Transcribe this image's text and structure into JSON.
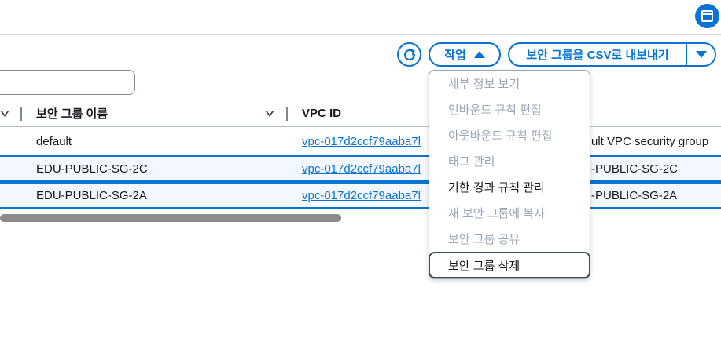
{
  "toolbar": {
    "actions_label": "작업",
    "export_label": "보안 그룹을 CSV로 내보내기",
    "search_value": ""
  },
  "table": {
    "columns": [
      "보안 그룹 이름",
      "VPC ID"
    ],
    "rows": [
      {
        "name": "default",
        "vpc": "vpc-017d2ccf79aaba7l",
        "desc": "ult VPC security group"
      },
      {
        "name": "EDU-PUBLIC-SG-2C",
        "vpc": "vpc-017d2ccf79aaba7l",
        "desc": "-PUBLIC-SG-2C"
      },
      {
        "name": "EDU-PUBLIC-SG-2A",
        "vpc": "vpc-017d2ccf79aaba7l",
        "desc": "-PUBLIC-SG-2A"
      }
    ]
  },
  "menu": {
    "items": [
      {
        "label": "세부 정보 보기",
        "disabled": true
      },
      {
        "label": "인바운드 규칙 편집",
        "disabled": true
      },
      {
        "label": "아웃바운드 규칙 편집",
        "disabled": true
      },
      {
        "label": "태그 관리",
        "disabled": true
      },
      {
        "label": "기한 경과 규칙 관리",
        "disabled": false
      },
      {
        "label": "새 보안 그룹에 복사",
        "disabled": true
      },
      {
        "label": "보안 그룹 공유",
        "disabled": true
      },
      {
        "label": "보안 그룹 삭제",
        "disabled": false,
        "focused": true
      }
    ]
  },
  "colors": {
    "accent": "#0972d3",
    "disabled": "#9ba7b6"
  }
}
